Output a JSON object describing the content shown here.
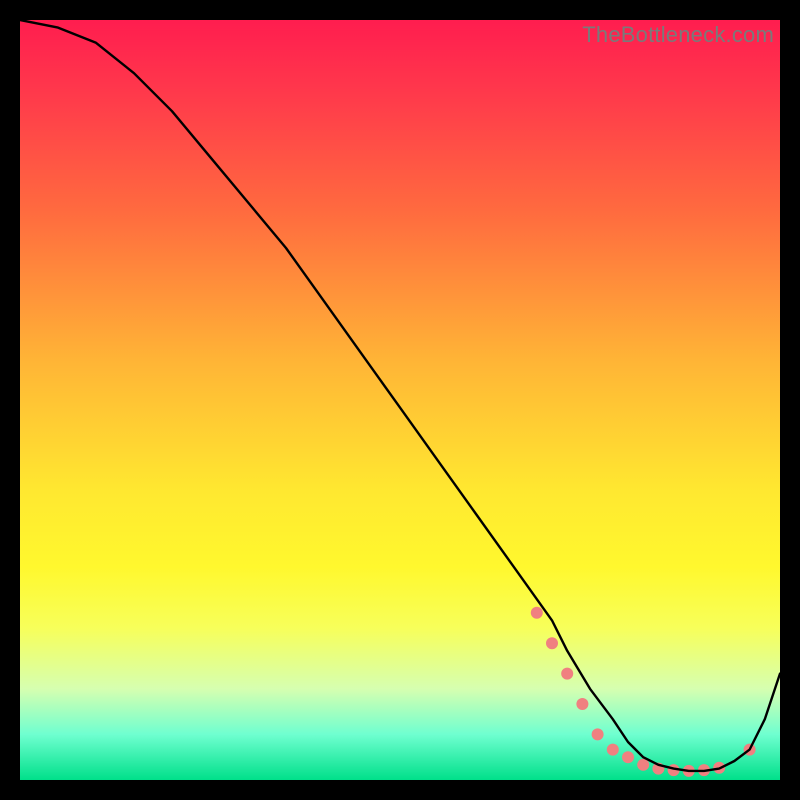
{
  "watermark": "TheBottleneck.com",
  "chart_data": {
    "type": "line",
    "title": "",
    "xlabel": "",
    "ylabel": "",
    "xlim": [
      0,
      100
    ],
    "ylim": [
      0,
      100
    ],
    "grid": false,
    "legend": false,
    "curve": {
      "name": "bottleneck-curve",
      "color": "#000000",
      "x": [
        0,
        5,
        10,
        15,
        20,
        25,
        30,
        35,
        40,
        45,
        50,
        55,
        60,
        65,
        70,
        72,
        75,
        78,
        80,
        82,
        84,
        86,
        88,
        90,
        92,
        94,
        96,
        98,
        100
      ],
      "y": [
        100,
        99,
        97,
        93,
        88,
        82,
        76,
        70,
        63,
        56,
        49,
        42,
        35,
        28,
        21,
        17,
        12,
        8,
        5,
        3,
        2,
        1.5,
        1.2,
        1.2,
        1.5,
        2.5,
        4,
        8,
        14
      ]
    },
    "markers": {
      "name": "flat-region-dots",
      "color": "#f08080",
      "radius": 6,
      "x": [
        68,
        70,
        72,
        74,
        76,
        78,
        80,
        82,
        84,
        86,
        88,
        90,
        92,
        96
      ],
      "y": [
        22,
        18,
        14,
        10,
        6,
        4,
        3,
        2,
        1.5,
        1.3,
        1.2,
        1.3,
        1.6,
        4
      ]
    }
  }
}
